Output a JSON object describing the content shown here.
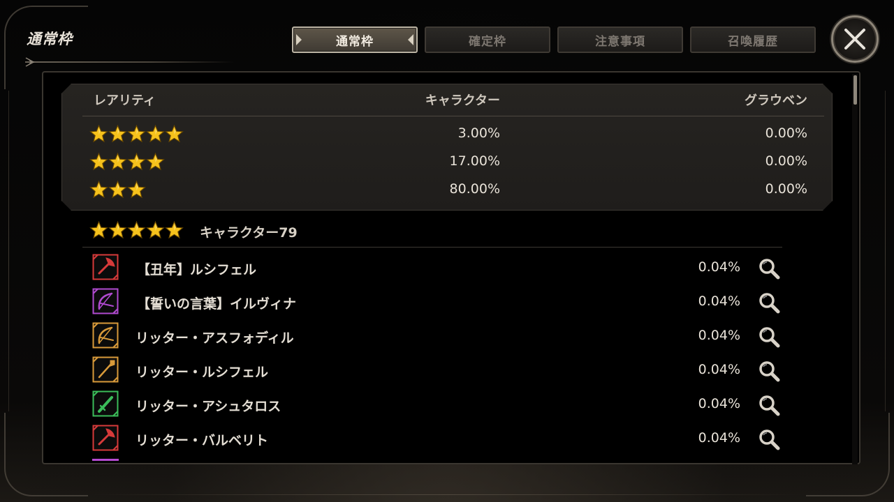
{
  "title": "通常枠",
  "tabs": [
    {
      "label": "通常枠",
      "active": true
    },
    {
      "label": "確定枠",
      "active": false
    },
    {
      "label": "注意事項",
      "active": false
    },
    {
      "label": "召喚履歴",
      "active": false
    }
  ],
  "close_icon": "close-x-icon",
  "rate_table": {
    "headers": {
      "rarity": "レアリティ",
      "character": "キャラクター",
      "graupen": "グラウベン"
    },
    "rows": [
      {
        "stars": 5,
        "character": "3.00%",
        "graupen": "0.00%"
      },
      {
        "stars": 4,
        "character": "17.00%",
        "graupen": "0.00%"
      },
      {
        "stars": 3,
        "character": "80.00%",
        "graupen": "0.00%"
      }
    ]
  },
  "section": {
    "stars": 5,
    "title": "キャラクター79"
  },
  "characters": [
    {
      "name": "【丑年】ルシフェル",
      "rate": "0.04%",
      "icon": "axe-icon",
      "color": "#d63a3a"
    },
    {
      "name": "【誓いの言葉】イルヴィナ",
      "rate": "0.04%",
      "icon": "bow-icon",
      "color": "#b04ad0"
    },
    {
      "name": "リッター・アスフォディル",
      "rate": "0.04%",
      "icon": "bow-icon",
      "color": "#d89a3a"
    },
    {
      "name": "リッター・ルシフェル",
      "rate": "0.04%",
      "icon": "spear-icon",
      "color": "#d89a3a"
    },
    {
      "name": "リッター・アシュタロス",
      "rate": "0.04%",
      "icon": "sword-icon",
      "color": "#3bbd5a"
    },
    {
      "name": "リッター・バルベリト",
      "rate": "0.04%",
      "icon": "axe-icon",
      "color": "#d63a3a"
    }
  ],
  "star_color": "#f6c21c",
  "search_icon": "magnifier-icon"
}
